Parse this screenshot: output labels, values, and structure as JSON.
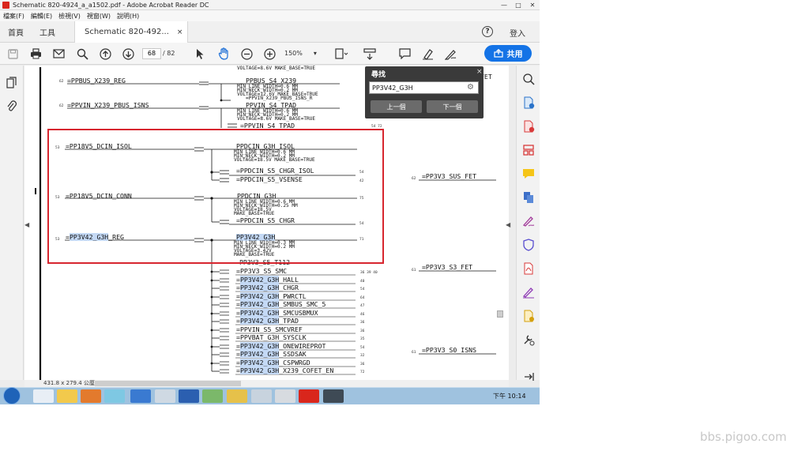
{
  "window": {
    "title": "Schematic 820-4924_a_a1502.pdf - Adobe Acrobat Reader DC",
    "controls": [
      "—",
      "□",
      "✕"
    ]
  },
  "menu": [
    "檔案(F)",
    "編輯(E)",
    "檢視(V)",
    "視窗(W)",
    "說明(H)"
  ],
  "tabs": {
    "home": "首頁",
    "tools": "工具",
    "document": "Schematic 820-492...",
    "close": "×",
    "help": "?",
    "login": "登入"
  },
  "toolbar": {
    "page_current": "68",
    "page_total": "/ 82",
    "zoom": "150%",
    "share_label": "共用"
  },
  "find": {
    "title": "尋找",
    "query": "PP3V42_G3H",
    "prev_label": "上一個",
    "next_label": "下一個",
    "close": "×"
  },
  "status": {
    "page_size": "431.8 x 279.4 公厘"
  },
  "taskbar": {
    "time": "下午 10:14"
  },
  "watermark": "bbs.pigoo.com",
  "schematic": {
    "top_left_nets": [
      "=PPBUS_X239_REG",
      "=PPVIN_X239_PBUS_ISNS"
    ],
    "top_net_names": [
      "PPBUS_S4_X239",
      "PPVIN_S4_TPAD"
    ],
    "top_props_1": [
      "VOLTAGE=8.6V  MAKE_BASE=TRUE",
      "MIN_LINE_WIDTH=0.6 MM",
      "MIN_NECK_WIDTH=0.2 MM",
      "VOLTAGE=12.6V  MAKE_BASE=TRUE"
    ],
    "top_sub_1": "=PPVIN_X239_PBUS_ISNS_R",
    "top_props_2": [
      "MIN_LINE_WIDTH=0.6 MM",
      "MIN_NECK_WIDTH=0.2 MM",
      "VOLTAGE=8.6V  MAKE_BASE=TRUE"
    ],
    "top_sub_2": "=PPVIN_S4_TPAD",
    "top_pg": [
      "62",
      "62",
      "54 72"
    ],
    "block1": {
      "input": "=PP18V5_DCIN_ISOL",
      "net": "PPDCIN_G3H_ISOL",
      "props": [
        "MIN_LINE_WIDTH=0.6 MM",
        "MIN_NECK_WIDTH=0.2 MM",
        "VOLTAGE=18.5V  MAKE_BASE=TRUE"
      ],
      "outputs": [
        "=PPDCIN_S5_CHGR_ISOL",
        "=PPDCIN_S5_VSENSE"
      ],
      "pg_in": "53",
      "pg_out": [
        "54",
        "42"
      ]
    },
    "block2": {
      "input": "=PP18V5_DCIN_CONN",
      "net": "PPDCIN_G3H",
      "props": [
        "MIN_LINE_WIDTH=0.6 MM",
        "MIN_NECK_WIDTH=0.25 MM",
        "VOLTAGE=18.5V",
        "MAKE_BASE=TRUE"
      ],
      "outputs": [
        "=PPDCIN_S5_CHGR"
      ],
      "pg_in": "53",
      "pg_out": [
        "75",
        "54"
      ]
    },
    "block3": {
      "input_prefix": "=",
      "input_hl": "PP3V42_G3H",
      "input_suffix": "_REG",
      "net_hl": "PP3V42_G3H",
      "props": [
        "MIN_LINE_WIDTH=0.3 MM",
        "MIN_NECK_WIDTH=0.2 MM",
        "VOLTAGE=3.42V",
        "MAKE_BASE=TRUE"
      ],
      "pg_in": "53",
      "pg_out": "71"
    },
    "under_box_partial": "PP3V3_S5_T112",
    "list": [
      {
        "pre": "=",
        "hl": "",
        "post": "PP3V3_S5_SMC",
        "pg": "36 39 40"
      },
      {
        "pre": "=",
        "hl": "PP3V42_G3H",
        "post": "_HALL",
        "pg": "40"
      },
      {
        "pre": "=",
        "hl": "PP3V42_G3H",
        "post": "_CHGR",
        "pg": "54"
      },
      {
        "pre": "=",
        "hl": "PP3V42_G3H",
        "post": "_PWRCTL",
        "pg": "64"
      },
      {
        "pre": "=",
        "hl": "PP3V42_G3H",
        "post": "_SMBUS_SMC_5",
        "pg": "47"
      },
      {
        "pre": "=",
        "hl": "PP3V42_G3H",
        "post": "_SMCUSBMUX",
        "pg": "46"
      },
      {
        "pre": "=",
        "hl": "PP3V42_G3H",
        "post": "_TPAD",
        "pg": "36"
      },
      {
        "pre": "=",
        "hl": "",
        "post": "PPVIN_S5_SMCVREF",
        "pg": "36"
      },
      {
        "pre": "=",
        "hl": "",
        "post": "PPVBAT_G3H_SYSCLK",
        "pg": "35"
      },
      {
        "pre": "=",
        "hl": "PP3V42_G3H",
        "post": "_ONEWIREPROT",
        "pg": "54"
      },
      {
        "pre": "=",
        "hl": "PP3V42_G3H",
        "post": "_SSDSAK",
        "pg": "32"
      },
      {
        "pre": "=",
        "hl": "PP3V42_G3H",
        "post": "_CSPWRGD",
        "pg": "36"
      },
      {
        "pre": "=",
        "hl": "PP3V42_G3H",
        "post": "_X239_COFET_EN",
        "pg": "72"
      }
    ],
    "right_nets": [
      {
        "label": "=PP3V3_SUS_FET",
        "pg": "62"
      },
      {
        "label": "=PP3V3_S3_FET",
        "pg": "61"
      },
      {
        "label": "=PP3V3_S0_ISNS",
        "pg": "61"
      }
    ],
    "right_top_partial": "FET"
  },
  "icons": {
    "save": "save-icon",
    "print": "print-icon",
    "mail": "mail-icon",
    "search": "search-icon",
    "up": "page-up-icon",
    "down": "page-down-icon",
    "select": "cursor-icon",
    "hand": "hand-icon",
    "zoom_out": "zoom-out-icon",
    "zoom_in": "zoom-in-icon",
    "fit": "fit-page-icon",
    "scroll": "scroll-mode-icon",
    "comment": "comment-icon",
    "highlight": "highlight-icon",
    "sign": "sign-icon",
    "share": "share-icon"
  },
  "colors": {
    "accent": "#1473e6",
    "highlight": "#c4d9f5",
    "redbox": "#d7262f",
    "adobe_red": "#d9261c"
  }
}
